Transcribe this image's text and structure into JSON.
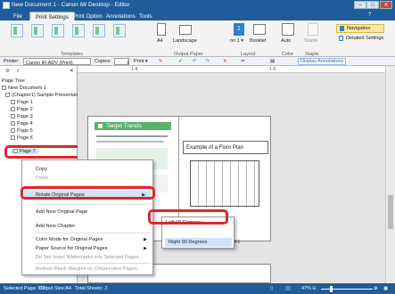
{
  "window": {
    "title": "New Document 1 - Canon iW Desktop - Editor"
  },
  "tabs": [
    "File",
    "Print Settings",
    "Print Option",
    "Annotations",
    "Tools"
  ],
  "ribbon": {
    "groups": {
      "templates": "Templates",
      "output_paper": "Output Paper",
      "layout": "Layout",
      "color": "Color",
      "staple": "Staple"
    },
    "buttons": {
      "a4": "A4",
      "landscape": "Landscape",
      "on1": "on 1 ▾",
      "booklet": "Booklet",
      "auto": "Auto",
      "staple": "Staple",
      "navigation": "Navigation",
      "detailed_settings": "Detailed Settings"
    }
  },
  "toolbar": {
    "printer_label": "Printer:",
    "printer_value": "Canon iR-ADV (Print)",
    "copies_label": "Copies:",
    "copies_value": "1",
    "print": "Print ▾",
    "display_annotations": "Display Annotations"
  },
  "ruler": {
    "left": "1-4",
    "right": "1-5"
  },
  "tree": {
    "title": "Page Tree",
    "items": [
      "New Document 1",
      "(Chapter1) Sample Presentatio",
      "Page 1",
      "Page 2",
      "Page 3",
      "Page 4",
      "Page 5",
      "Page 6",
      "Page 7"
    ]
  },
  "pages": {
    "slide_title": "Target Trends",
    "plan_title": "Example of a Floor Plan",
    "page_label": "3-1"
  },
  "context_menu": {
    "items": [
      "Copy",
      "Paste",
      "Rotate Original Pages",
      "Add New Original Page",
      "Add New Chapter",
      "Color Mode for Original Pages",
      "Paper Source for Original Pages",
      "Do Not Insert Watermarks into Selected Pages",
      "Reduce Blank Margins on Consecutive Pages"
    ]
  },
  "submenu": {
    "items": [
      "Left 90 Degrees",
      "Right 90 Degrees"
    ]
  },
  "status": {
    "selected": "Selected Page: 7/7",
    "output_size": "Output Size:A4",
    "total_sheets": "Total Sheets: 2",
    "zoom": "47%"
  },
  "colors": {
    "highlight": "#e0262b",
    "title_blue": "#1f5c99",
    "slide_green": "#58b368"
  }
}
